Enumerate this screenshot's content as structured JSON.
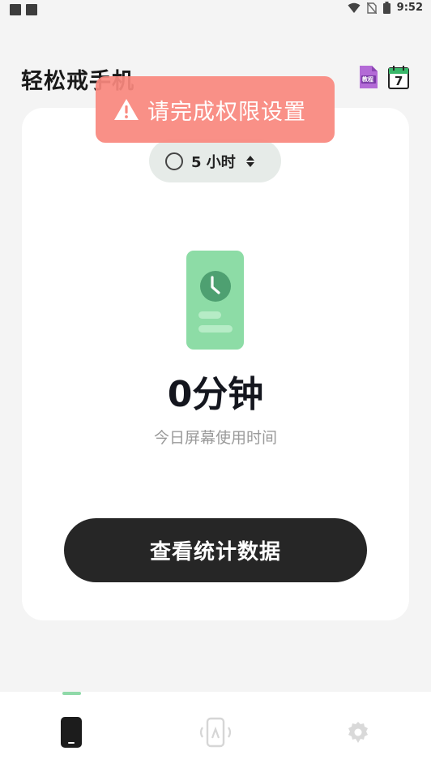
{
  "status_bar": {
    "time": "9:52"
  },
  "header": {
    "title": "轻松戒手机",
    "tutorial_icon_label": "教程",
    "calendar_icon_day": "7"
  },
  "toast": {
    "message": "请完成权限设置",
    "color": "#f9887e"
  },
  "limit_selector": {
    "label": "5 小时"
  },
  "usage": {
    "value": "0分钟",
    "caption": "今日屏幕使用时间"
  },
  "stats_button": {
    "label": "查看统计数据"
  },
  "bottom_nav": {
    "items": [
      {
        "icon": "phone-icon",
        "active": true
      },
      {
        "icon": "app-lock-icon",
        "active": false
      },
      {
        "icon": "settings-icon",
        "active": false
      }
    ],
    "accent": "#8fd9a8"
  }
}
